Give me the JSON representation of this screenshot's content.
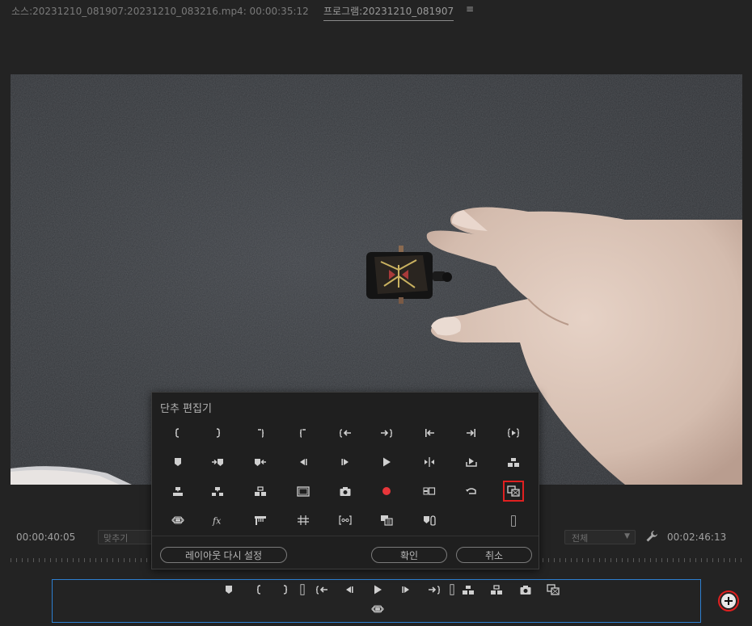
{
  "tabs": {
    "source": "소스:20231210_081907:20231210_083216.mp4: 00:00:35:12",
    "program": "프로그램:20231210_081907",
    "menu_glyph": "≡"
  },
  "monitor": {
    "current_time": "00:00:40:05",
    "fit_label": "맞추기",
    "resolution_label": "전체",
    "duration": "00:02:46:13"
  },
  "dialog": {
    "title": "단추 편집기",
    "reset_layout_label": "레이아웃 다시 설정",
    "ok_label": "확인",
    "cancel_label": "취소",
    "icons": [
      [
        "mark-in-icon",
        "mark-out-icon",
        "clear-in-icon",
        "clear-out-icon",
        "go-to-in-icon",
        "go-to-out-icon",
        "go-to-in-point-icon",
        "go-to-out-point-icon",
        "play-in-to-out-icon"
      ],
      [
        "add-marker-icon",
        "go-to-next-marker-icon",
        "go-to-prev-marker-icon",
        "step-back-icon",
        "step-forward-icon",
        "play-icon",
        "play-around-icon",
        "export-frame-icon",
        "lift-icon"
      ],
      [
        "overwrite-icon",
        "insert-icon",
        "extract-icon",
        "safe-margins-icon",
        "camera-icon",
        "record-icon",
        "multi-camera-icon",
        "loop-icon",
        "comparison-view-icon"
      ],
      [
        "vr-video-icon",
        "fx-icon",
        "transmit-icon",
        "grid-icon",
        "trim-icon",
        "toggle-proxies-icon",
        "clear-marker-icon",
        "spacer-icon"
      ]
    ]
  },
  "transport": {
    "icons": [
      "add-marker-icon",
      "mark-in-icon",
      "mark-out-icon",
      "spacer-icon",
      "go-to-in-icon",
      "step-back-icon",
      "play-icon",
      "step-forward-icon",
      "go-to-out-icon",
      "spacer-icon",
      "lift-icon",
      "extract-icon",
      "camera-icon",
      "comparison-view-icon",
      "vr-video-icon"
    ]
  },
  "colors": {
    "accent_blue": "#2d7fd0",
    "highlight_red": "#e02020",
    "record_red": "#e8363a"
  }
}
